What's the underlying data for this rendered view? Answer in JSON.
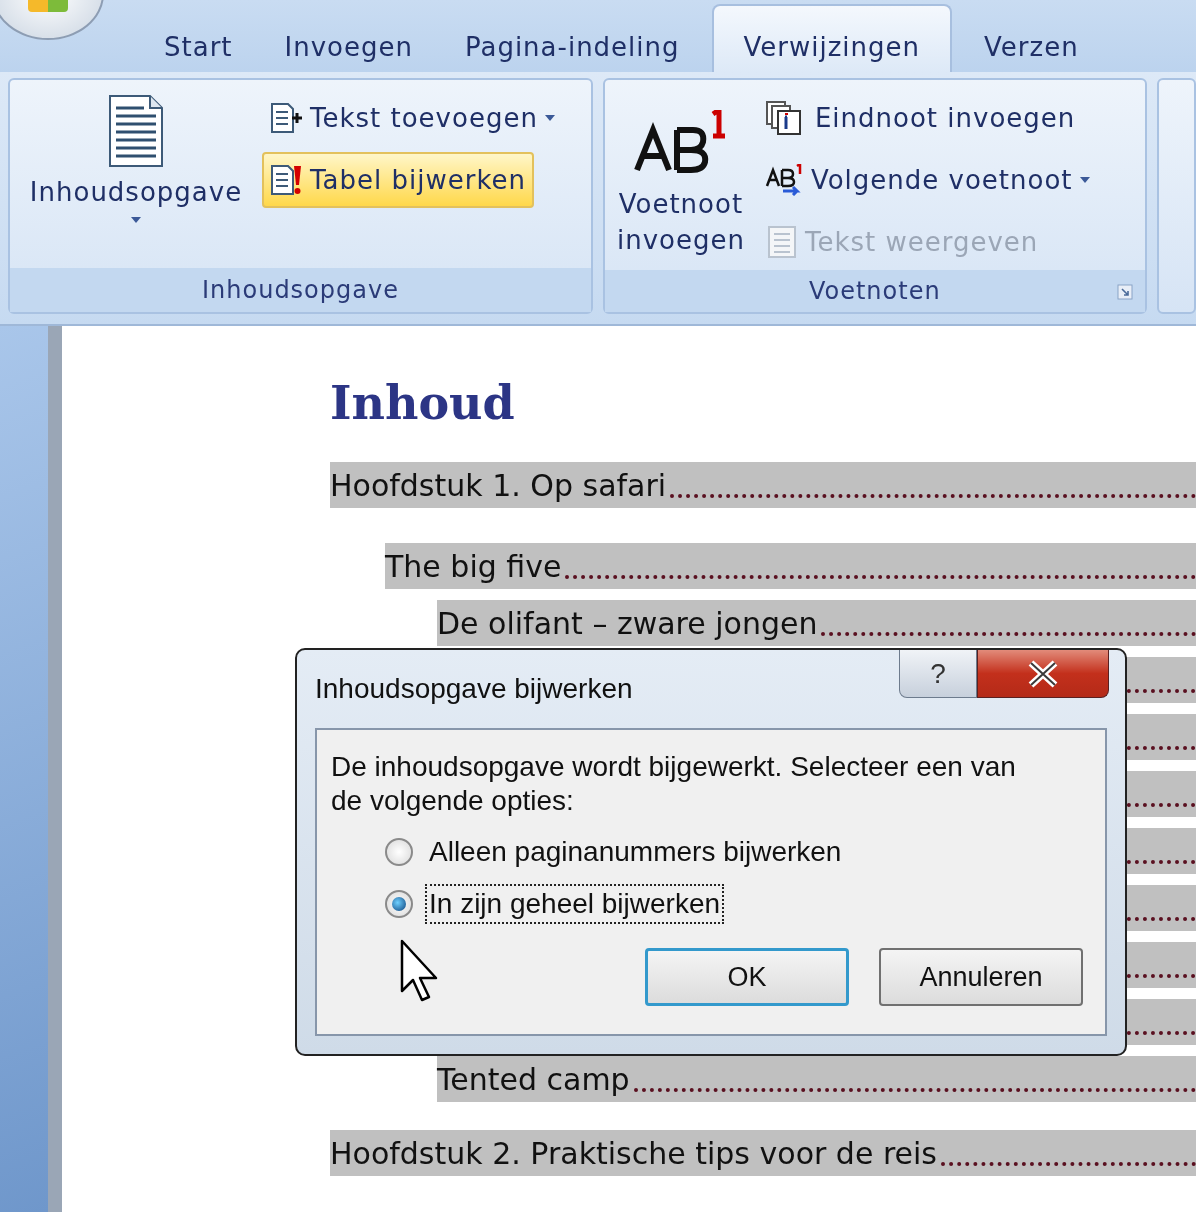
{
  "ribbon": {
    "tabs": [
      {
        "label": "Start",
        "selected": false
      },
      {
        "label": "Invoegen",
        "selected": false
      },
      {
        "label": "Pagina-indeling",
        "selected": false
      },
      {
        "label": "Verwijzingen",
        "selected": true
      },
      {
        "label": "Verzen",
        "selected": false
      }
    ],
    "groups": [
      {
        "label": "Inhoudsopgave",
        "dialog_launcher": false,
        "large": {
          "kind": "toc",
          "label": "Inhoudsopgave",
          "dropdown": true
        },
        "items": [
          {
            "kind": "addtext",
            "label": "Tekst toevoegen",
            "dropdown": true,
            "highlighted": false,
            "disabled": false
          },
          {
            "kind": "update",
            "label": "Tabel bijwerken",
            "dropdown": false,
            "highlighted": true,
            "disabled": false
          }
        ]
      },
      {
        "label": "Voetnoten",
        "dialog_launcher": true,
        "large": {
          "kind": "footnote",
          "label": "Voetnoot invoegen",
          "dropdown": false
        },
        "items": [
          {
            "kind": "endnote",
            "label": "Eindnoot invoegen",
            "dropdown": false,
            "highlighted": false,
            "disabled": false
          },
          {
            "kind": "next",
            "label": "Volgende voetnoot",
            "dropdown": true,
            "highlighted": false,
            "disabled": false
          },
          {
            "kind": "show",
            "label": "Tekst weergeven",
            "dropdown": false,
            "highlighted": false,
            "disabled": true
          }
        ]
      }
    ]
  },
  "document": {
    "heading": "Inhoud",
    "toc": [
      {
        "kind": "entry",
        "text": "Hoofdstuk 1. Op safari",
        "children": [
          {
            "kind": "entry",
            "text": "The big five",
            "children": [
              {
                "kind": "entry",
                "text": "De olifant – zware jongen"
              },
              {
                "kind": "covered"
              },
              {
                "kind": "covered"
              },
              {
                "kind": "covered"
              },
              {
                "kind": "covered"
              },
              {
                "kind": "covered"
              },
              {
                "kind": "covered"
              },
              {
                "kind": "covered"
              },
              {
                "kind": "entry",
                "text": "Tented camp"
              }
            ]
          }
        ]
      },
      {
        "kind": "entry",
        "text": "Hoofdstuk 2. Praktische tips voor de reis"
      }
    ]
  },
  "dialog": {
    "title": "Inhoudsopgave bijwerken",
    "help_button": "?",
    "message": "De inhoudsopgave wordt bijgewerkt. Selecteer een van de volgende opties:",
    "options": [
      {
        "label": "Alleen paginanummers bijwerken",
        "selected": false,
        "focused": false
      },
      {
        "label": "In zijn geheel bijwerken",
        "selected": true,
        "focused": true
      }
    ],
    "buttons": [
      {
        "label": "OK",
        "default": true
      },
      {
        "label": "Annuleren",
        "default": false
      }
    ]
  }
}
